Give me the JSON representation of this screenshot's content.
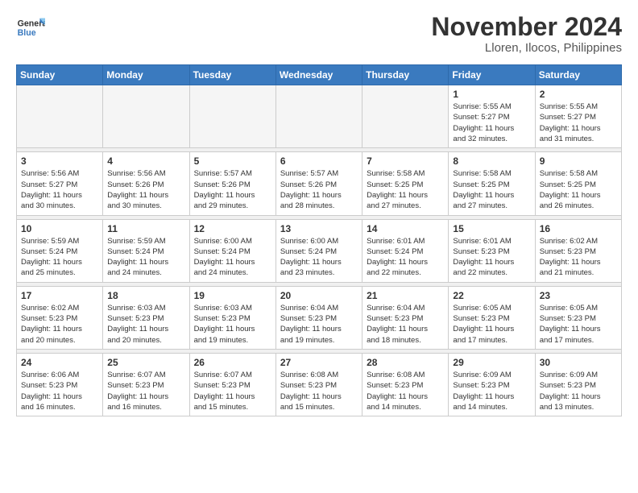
{
  "logo": {
    "line1": "General",
    "line2": "Blue"
  },
  "title": "November 2024",
  "location": "Lloren, Ilocos, Philippines",
  "days_of_week": [
    "Sunday",
    "Monday",
    "Tuesday",
    "Wednesday",
    "Thursday",
    "Friday",
    "Saturday"
  ],
  "weeks": [
    [
      {
        "day": "",
        "info": ""
      },
      {
        "day": "",
        "info": ""
      },
      {
        "day": "",
        "info": ""
      },
      {
        "day": "",
        "info": ""
      },
      {
        "day": "",
        "info": ""
      },
      {
        "day": "1",
        "info": "Sunrise: 5:55 AM\nSunset: 5:27 PM\nDaylight: 11 hours\nand 32 minutes."
      },
      {
        "day": "2",
        "info": "Sunrise: 5:55 AM\nSunset: 5:27 PM\nDaylight: 11 hours\nand 31 minutes."
      }
    ],
    [
      {
        "day": "3",
        "info": "Sunrise: 5:56 AM\nSunset: 5:27 PM\nDaylight: 11 hours\nand 30 minutes."
      },
      {
        "day": "4",
        "info": "Sunrise: 5:56 AM\nSunset: 5:26 PM\nDaylight: 11 hours\nand 30 minutes."
      },
      {
        "day": "5",
        "info": "Sunrise: 5:57 AM\nSunset: 5:26 PM\nDaylight: 11 hours\nand 29 minutes."
      },
      {
        "day": "6",
        "info": "Sunrise: 5:57 AM\nSunset: 5:26 PM\nDaylight: 11 hours\nand 28 minutes."
      },
      {
        "day": "7",
        "info": "Sunrise: 5:58 AM\nSunset: 5:25 PM\nDaylight: 11 hours\nand 27 minutes."
      },
      {
        "day": "8",
        "info": "Sunrise: 5:58 AM\nSunset: 5:25 PM\nDaylight: 11 hours\nand 27 minutes."
      },
      {
        "day": "9",
        "info": "Sunrise: 5:58 AM\nSunset: 5:25 PM\nDaylight: 11 hours\nand 26 minutes."
      }
    ],
    [
      {
        "day": "10",
        "info": "Sunrise: 5:59 AM\nSunset: 5:24 PM\nDaylight: 11 hours\nand 25 minutes."
      },
      {
        "day": "11",
        "info": "Sunrise: 5:59 AM\nSunset: 5:24 PM\nDaylight: 11 hours\nand 24 minutes."
      },
      {
        "day": "12",
        "info": "Sunrise: 6:00 AM\nSunset: 5:24 PM\nDaylight: 11 hours\nand 24 minutes."
      },
      {
        "day": "13",
        "info": "Sunrise: 6:00 AM\nSunset: 5:24 PM\nDaylight: 11 hours\nand 23 minutes."
      },
      {
        "day": "14",
        "info": "Sunrise: 6:01 AM\nSunset: 5:24 PM\nDaylight: 11 hours\nand 22 minutes."
      },
      {
        "day": "15",
        "info": "Sunrise: 6:01 AM\nSunset: 5:23 PM\nDaylight: 11 hours\nand 22 minutes."
      },
      {
        "day": "16",
        "info": "Sunrise: 6:02 AM\nSunset: 5:23 PM\nDaylight: 11 hours\nand 21 minutes."
      }
    ],
    [
      {
        "day": "17",
        "info": "Sunrise: 6:02 AM\nSunset: 5:23 PM\nDaylight: 11 hours\nand 20 minutes."
      },
      {
        "day": "18",
        "info": "Sunrise: 6:03 AM\nSunset: 5:23 PM\nDaylight: 11 hours\nand 20 minutes."
      },
      {
        "day": "19",
        "info": "Sunrise: 6:03 AM\nSunset: 5:23 PM\nDaylight: 11 hours\nand 19 minutes."
      },
      {
        "day": "20",
        "info": "Sunrise: 6:04 AM\nSunset: 5:23 PM\nDaylight: 11 hours\nand 19 minutes."
      },
      {
        "day": "21",
        "info": "Sunrise: 6:04 AM\nSunset: 5:23 PM\nDaylight: 11 hours\nand 18 minutes."
      },
      {
        "day": "22",
        "info": "Sunrise: 6:05 AM\nSunset: 5:23 PM\nDaylight: 11 hours\nand 17 minutes."
      },
      {
        "day": "23",
        "info": "Sunrise: 6:05 AM\nSunset: 5:23 PM\nDaylight: 11 hours\nand 17 minutes."
      }
    ],
    [
      {
        "day": "24",
        "info": "Sunrise: 6:06 AM\nSunset: 5:23 PM\nDaylight: 11 hours\nand 16 minutes."
      },
      {
        "day": "25",
        "info": "Sunrise: 6:07 AM\nSunset: 5:23 PM\nDaylight: 11 hours\nand 16 minutes."
      },
      {
        "day": "26",
        "info": "Sunrise: 6:07 AM\nSunset: 5:23 PM\nDaylight: 11 hours\nand 15 minutes."
      },
      {
        "day": "27",
        "info": "Sunrise: 6:08 AM\nSunset: 5:23 PM\nDaylight: 11 hours\nand 15 minutes."
      },
      {
        "day": "28",
        "info": "Sunrise: 6:08 AM\nSunset: 5:23 PM\nDaylight: 11 hours\nand 14 minutes."
      },
      {
        "day": "29",
        "info": "Sunrise: 6:09 AM\nSunset: 5:23 PM\nDaylight: 11 hours\nand 14 minutes."
      },
      {
        "day": "30",
        "info": "Sunrise: 6:09 AM\nSunset: 5:23 PM\nDaylight: 11 hours\nand 13 minutes."
      }
    ]
  ]
}
